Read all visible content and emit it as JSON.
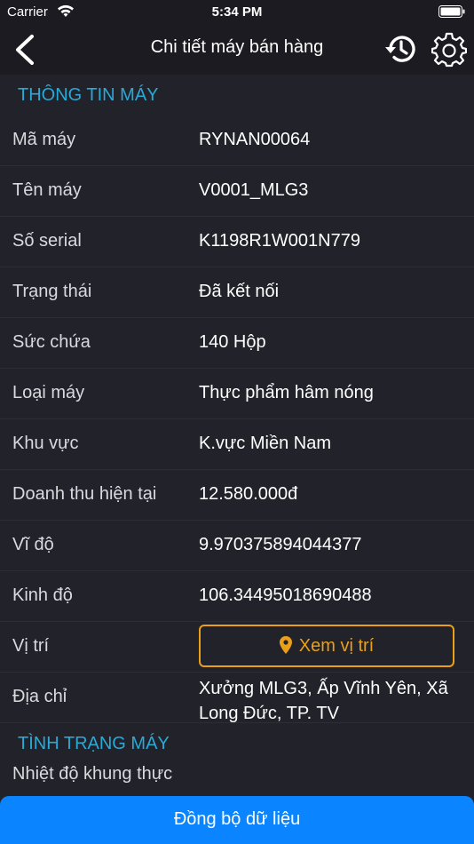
{
  "status_bar": {
    "carrier": "Carrier",
    "time": "5:34 PM"
  },
  "nav": {
    "title": "Chi tiết máy bán hàng"
  },
  "machine_info": {
    "header": "THÔNG TIN MÁY",
    "rows": [
      {
        "label": "Mã máy",
        "value": "RYNAN00064"
      },
      {
        "label": "Tên máy",
        "value": "V0001_MLG3"
      },
      {
        "label": "Số serial",
        "value": "K1198R1W001N779"
      },
      {
        "label": "Trạng thái",
        "value": "Đã kết nối"
      },
      {
        "label": "Sức chứa",
        "value": "140 Hộp"
      },
      {
        "label": "Loại máy",
        "value": "Thực phẩm hâm nóng"
      },
      {
        "label": "Khu vực",
        "value": "K.vực Miền Nam"
      },
      {
        "label": "Doanh thu hiện tại",
        "value": "12.580.000đ"
      },
      {
        "label": "Vĩ độ",
        "value": "9.970375894044377"
      },
      {
        "label": "Kinh độ",
        "value": "106.34495018690488"
      }
    ],
    "location_label": "Vị trí",
    "location_button": "Xem vị trí",
    "address_label": "Địa chỉ",
    "address_value": "Xưởng MLG3, Ấp Vĩnh Yên, Xã Long Đức, TP. TV"
  },
  "machine_status": {
    "header": "TÌNH TRẠNG MÁY",
    "partial_label": "Nhiệt độ khung thực"
  },
  "sync_button": "Đồng bộ dữ liệu",
  "colors": {
    "accent_blue": "#29a9d6",
    "button_orange": "#e9a018",
    "sync_blue": "#0a84ff"
  }
}
